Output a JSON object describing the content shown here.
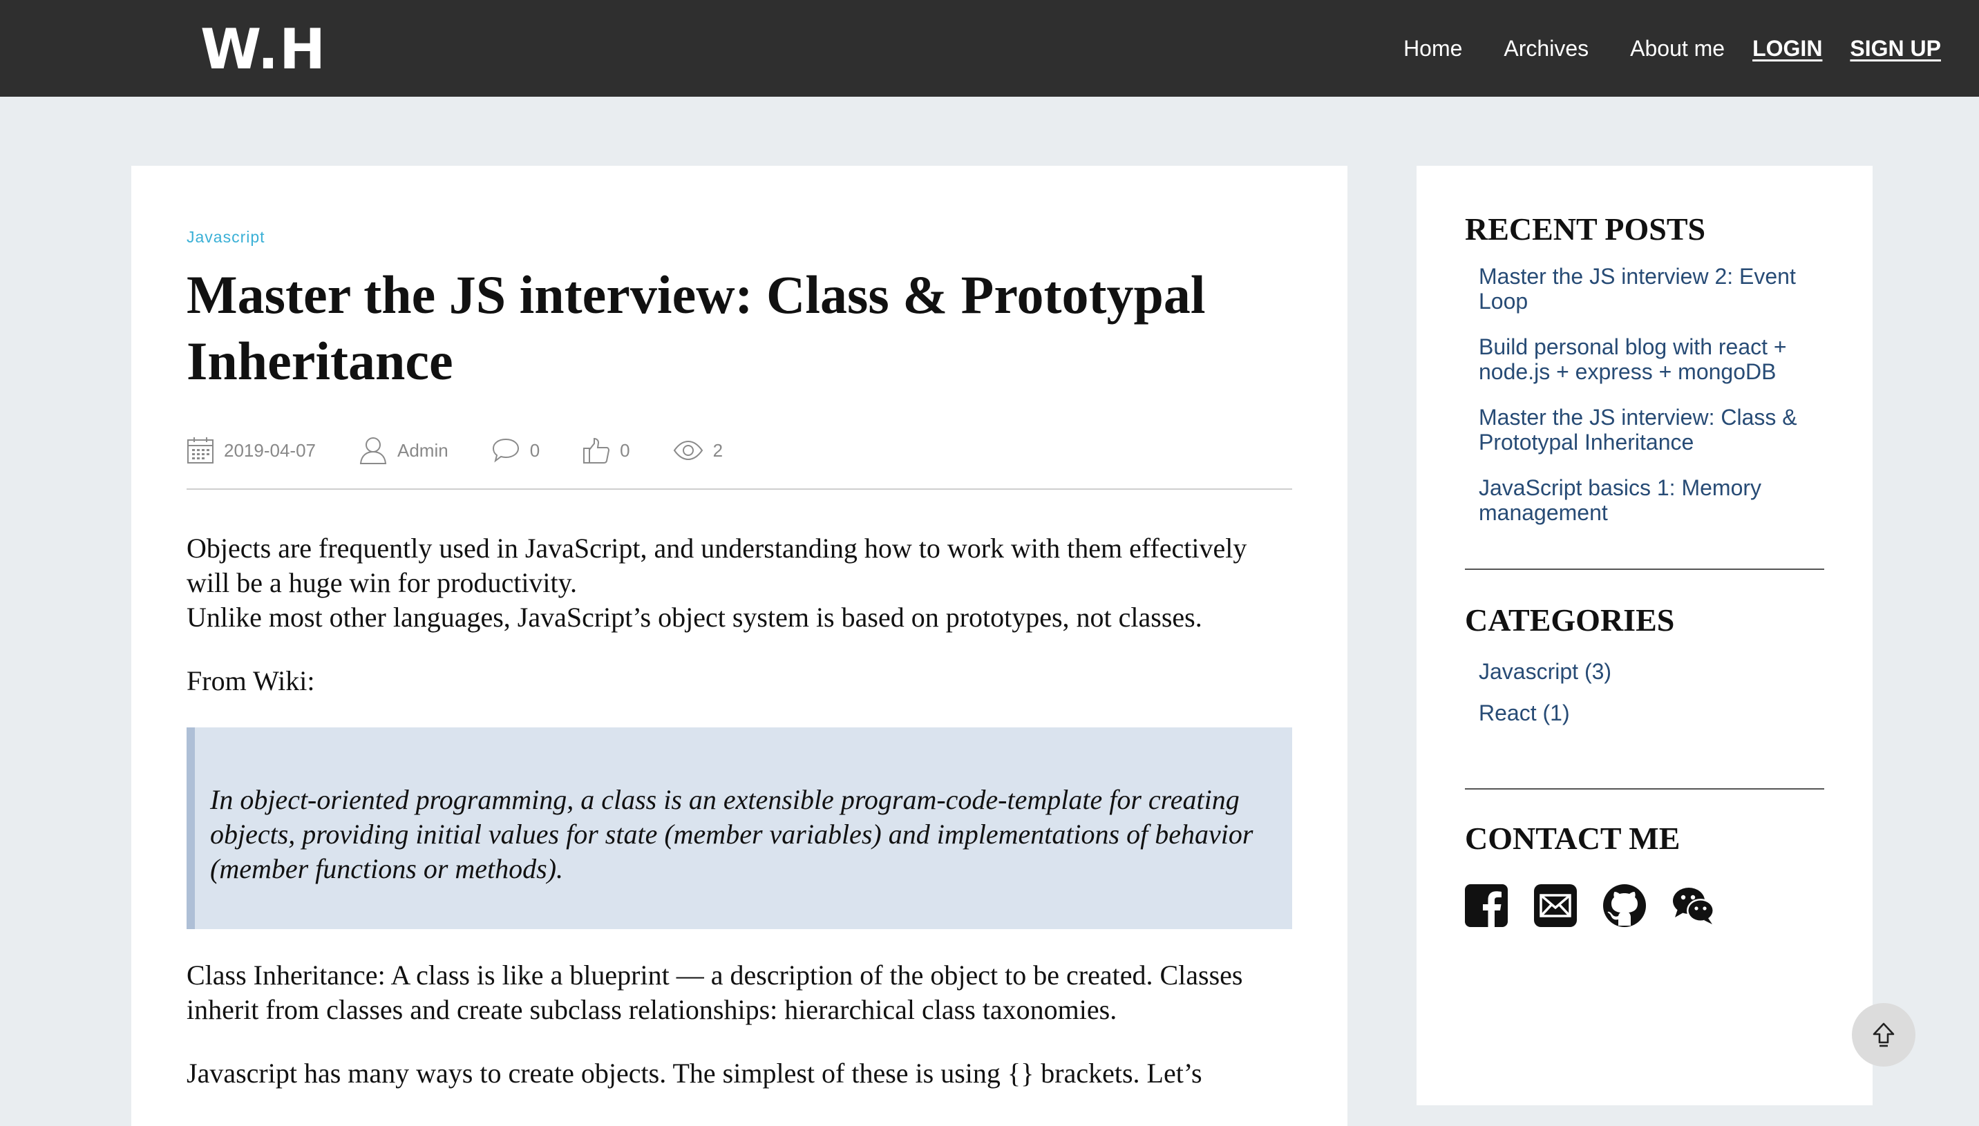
{
  "header": {
    "logo": "W.H",
    "nav": [
      {
        "label": "Home"
      },
      {
        "label": "Archives"
      },
      {
        "label": "About me"
      }
    ],
    "login_label": "LOGIN",
    "signup_label": "SIGN UP"
  },
  "article": {
    "category": "Javascript",
    "title": "Master the JS interview: Class & Prototypal Inheritance",
    "meta": {
      "date": "2019-04-07",
      "author": "Admin",
      "comments": "0",
      "likes": "0",
      "views": "2"
    },
    "body": {
      "intro_line1": "Objects are frequently used in JavaScript, and understanding how to work with them effectively will be a huge win for productivity.",
      "intro_line2": "Unlike most other languages, JavaScript’s object system is based on prototypes, not classes.",
      "from_wiki": "From Wiki:",
      "quote": "In object-oriented programming, a class is an extensible program-code-template for creating objects, providing initial values for state (member variables) and implementations of behavior (member functions or methods).",
      "class_inheritance": "Class Inheritance: A class is like a blueprint — a description of the object to be created. Classes inherit from classes and create subclass relationships: hierarchical class taxonomies.",
      "ways": "Javascript has many ways to create objects. The simplest of these is using {} brackets. Let’s"
    }
  },
  "sidebar": {
    "recent_heading": "RECENT POSTS",
    "recent_posts": [
      {
        "label": "Master the JS interview 2: Event Loop"
      },
      {
        "label": "Build personal blog with react + node.js + express + mongoDB"
      },
      {
        "label": "Master the JS interview: Class & Prototypal Inheritance"
      },
      {
        "label": "JavaScript basics 1: Memory management"
      }
    ],
    "categories_heading": "CATEGORIES",
    "categories": [
      {
        "label": "Javascript (3)"
      },
      {
        "label": "React (1)"
      }
    ],
    "contact_heading": "CONTACT ME",
    "contact_icons": [
      "facebook-icon",
      "mail-icon",
      "github-icon",
      "wechat-icon"
    ]
  },
  "colors": {
    "header_bg": "#2f2f2f",
    "page_bg": "#e9edf0",
    "category_tag": "#3ab0d6",
    "sidebar_link": "#274b75",
    "quote_bg": "#dae3ee",
    "quote_border": "#aebfd6"
  }
}
